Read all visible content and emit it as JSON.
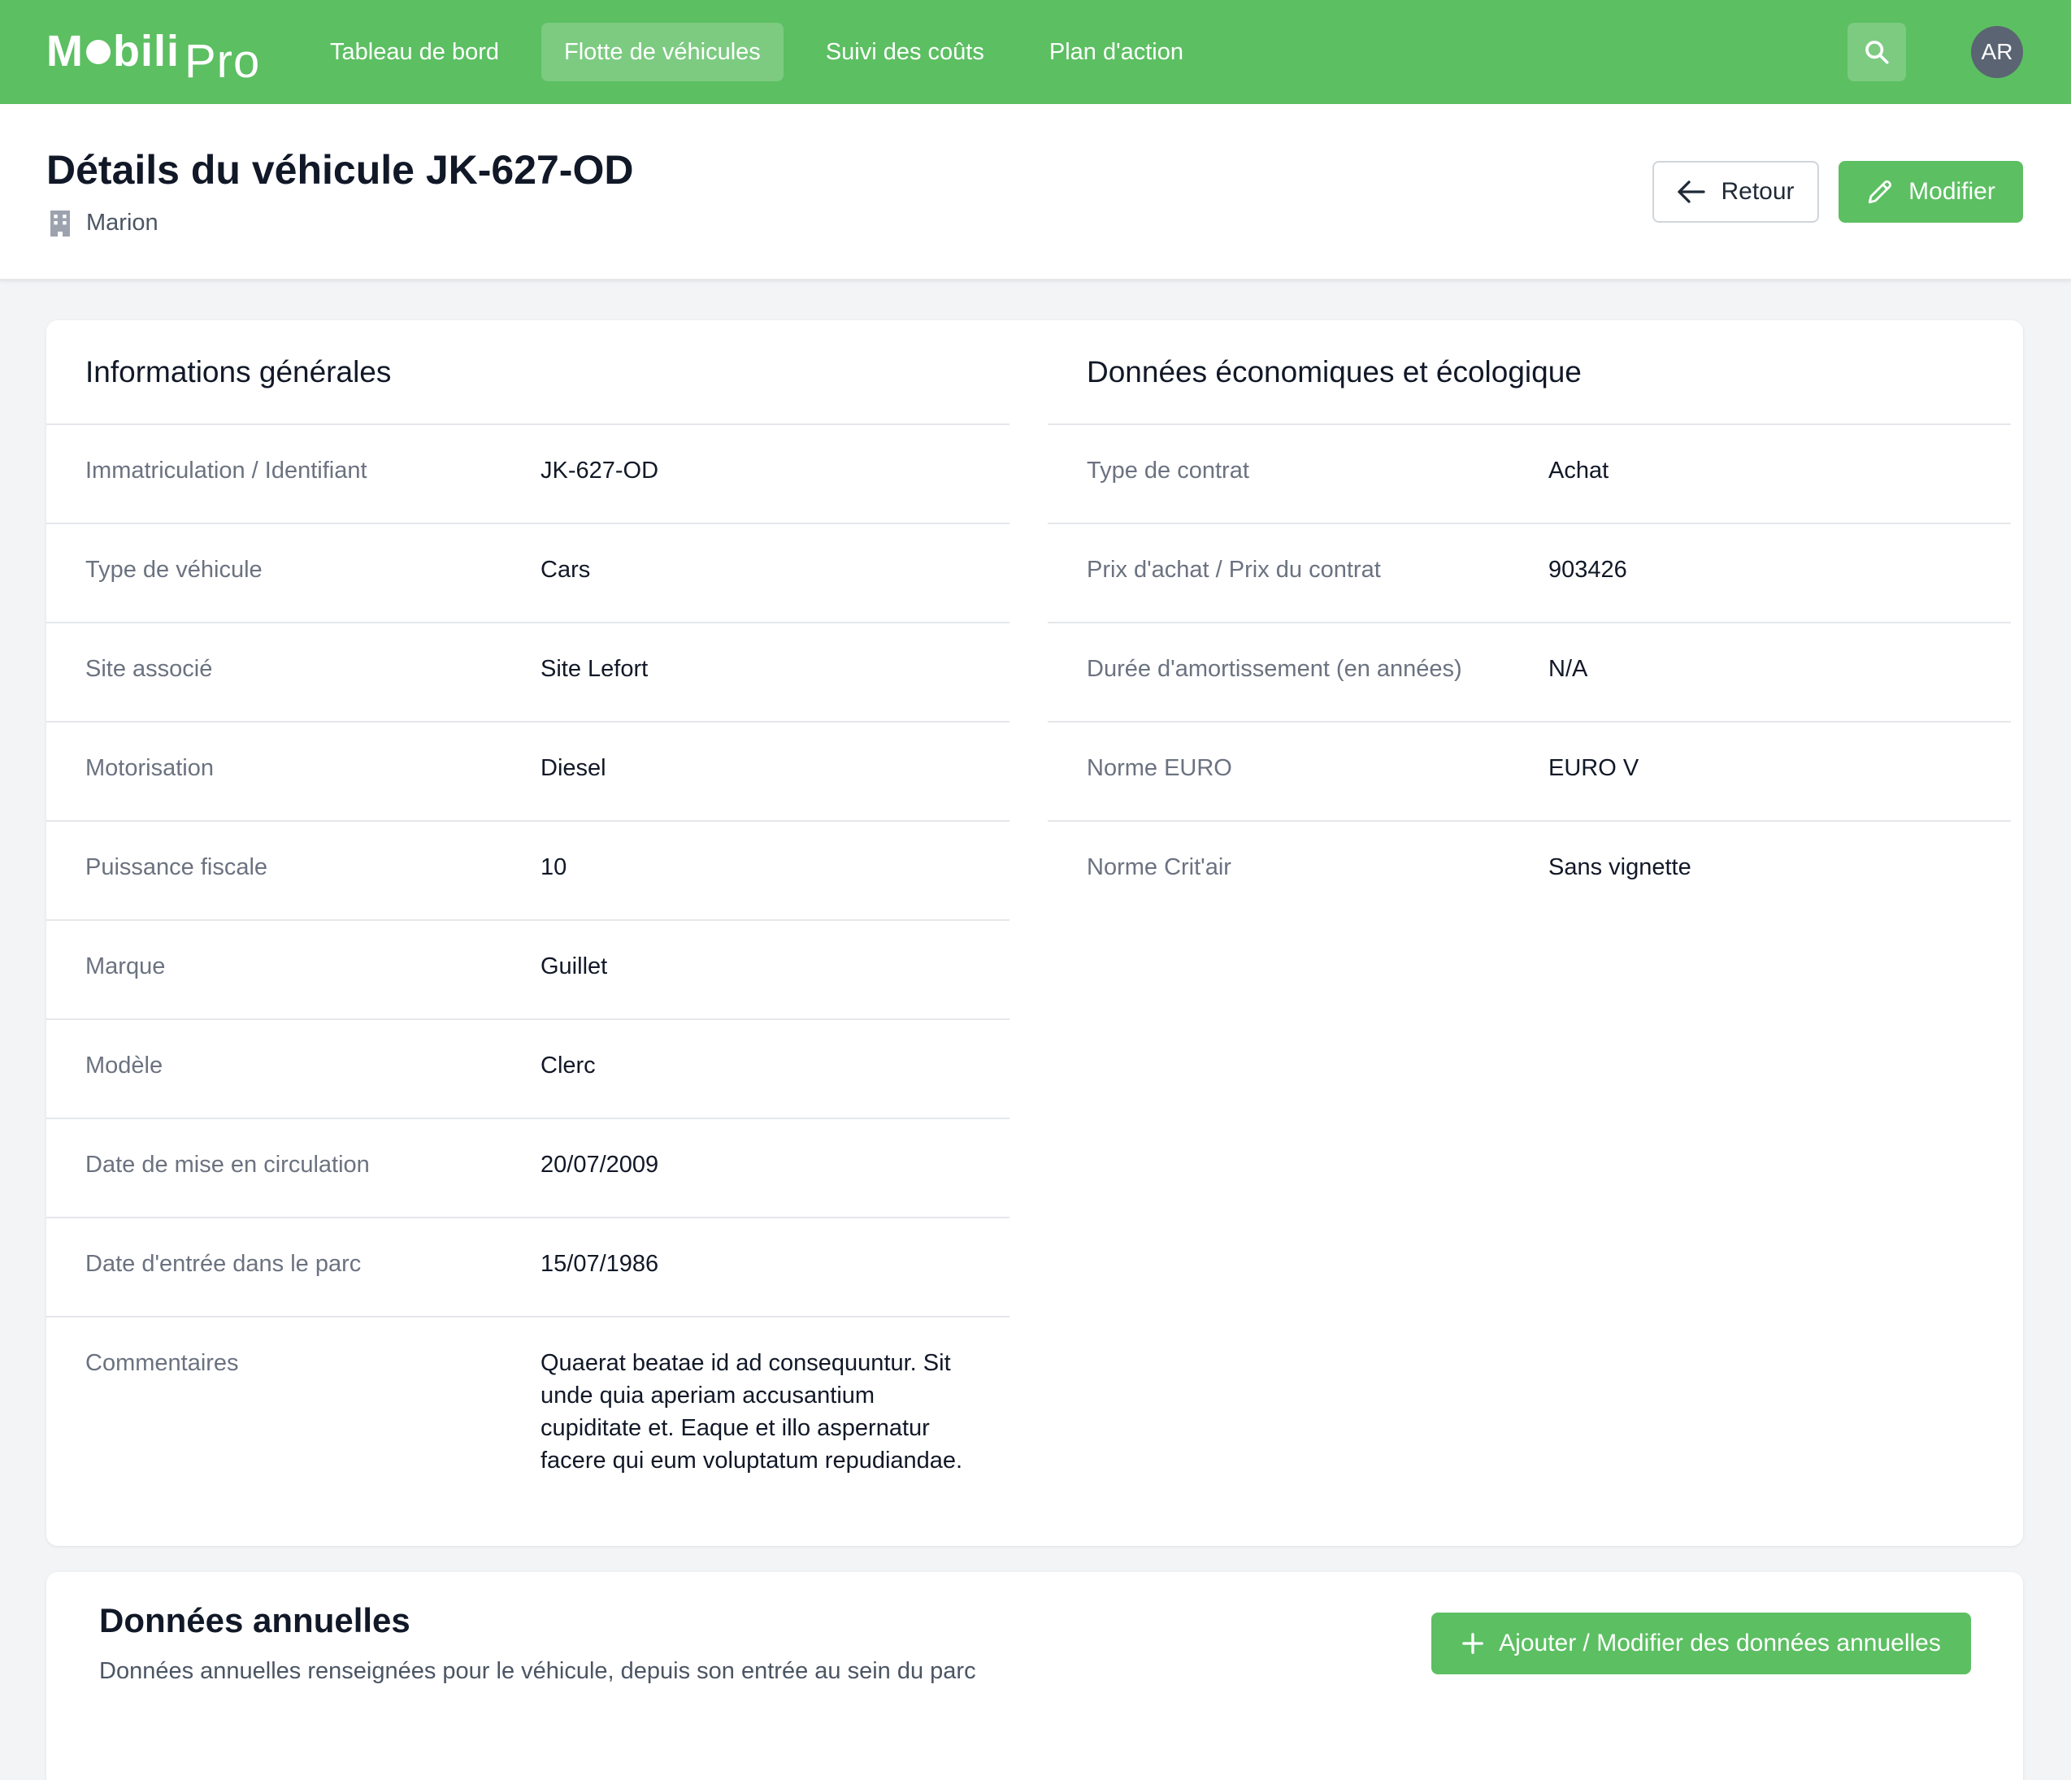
{
  "brand": {
    "name_part1": "M",
    "name_part2": "bili",
    "name_part3": "Pro"
  },
  "nav": {
    "items": [
      {
        "label": "Tableau de bord",
        "active": false
      },
      {
        "label": "Flotte de véhicules",
        "active": true
      },
      {
        "label": "Suivi des coûts",
        "active": false
      },
      {
        "label": "Plan d'action",
        "active": false
      }
    ],
    "search_icon": "search-icon",
    "avatar_initials": "AR"
  },
  "header": {
    "title": "Détails du véhicule JK-627-OD",
    "site_icon": "building-icon",
    "site_name": "Marion",
    "back_label": "Retour",
    "edit_label": "Modifier"
  },
  "general": {
    "title": "Informations générales",
    "rows": [
      {
        "label": "Immatriculation / Identifiant",
        "value": "JK-627-OD"
      },
      {
        "label": "Type de véhicule",
        "value": "Cars"
      },
      {
        "label": "Site associé",
        "value": "Site Lefort"
      },
      {
        "label": "Motorisation",
        "value": "Diesel"
      },
      {
        "label": "Puissance fiscale",
        "value": "10"
      },
      {
        "label": "Marque",
        "value": "Guillet"
      },
      {
        "label": "Modèle",
        "value": "Clerc"
      },
      {
        "label": "Date de mise en circulation",
        "value": "20/07/2009"
      },
      {
        "label": "Date d'entrée dans le parc",
        "value": "15/07/1986"
      },
      {
        "label": "Commentaires",
        "value": "Quaerat beatae id ad consequuntur. Sit unde quia aperiam accusantium cupiditate et. Eaque et illo aspernatur facere qui eum voluptatum repudiandae."
      }
    ]
  },
  "economic": {
    "title": "Données économiques et écologique",
    "rows": [
      {
        "label": "Type de contrat",
        "value": "Achat"
      },
      {
        "label": "Prix d'achat / Prix du contrat",
        "value": "903426"
      },
      {
        "label": "Durée d'amortissement (en années)",
        "value": "N/A"
      },
      {
        "label": "Norme EURO",
        "value": "EURO V"
      },
      {
        "label": "Norme Crit'air",
        "value": "Sans vignette"
      }
    ]
  },
  "annual": {
    "title": "Données annuelles",
    "subtitle": "Données annuelles renseignées pour le véhicule, depuis son entrée au sein du parc",
    "button_label": "Ajouter / Modifier des données annuelles"
  },
  "colors": {
    "brand_green": "#5cbf62",
    "avatar_gray": "#5b6472"
  }
}
